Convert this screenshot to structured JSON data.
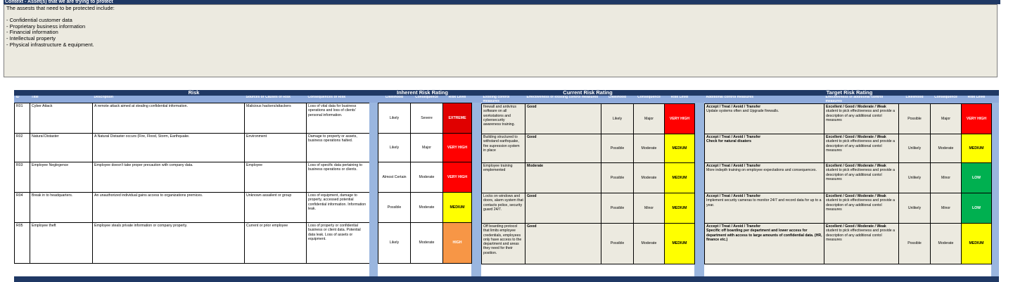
{
  "context": {
    "heading": "Context - Asset(s) that we are trying to protect",
    "intro": "The assests that need to be protected include:",
    "assets": [
      "- Confidential customer data",
      "- Proprietary business information",
      "- Financial information",
      "- Intellectual property",
      "- Physical infrastructure & equipment."
    ]
  },
  "colors": {
    "header_blue": "#1f3864",
    "subheader_blue": "#8eaadb",
    "extreme": "#e00000",
    "very_high": "#ff0000",
    "high": "#f79646",
    "medium": "#ffff00",
    "low": "#00b050"
  },
  "risk": {
    "title": "Risk",
    "headers": [
      "ID",
      "Title",
      "Description",
      "Sources or Causes of Risk",
      "Consequences of Risk"
    ]
  },
  "inherent": {
    "title": "Inherent Risk Rating",
    "headers": [
      "Likelihood",
      "Consequence",
      "Risk Level"
    ]
  },
  "current": {
    "title": "Current Risk Rating",
    "headers": [
      "Existing control measures",
      "Effectiveness of existing control measures",
      "Likelihood",
      "Consequence",
      "Risk Level"
    ]
  },
  "target": {
    "title": "Target Risk Rating",
    "headers": [
      "Additional control measures",
      "Effectiveness of additional control measures",
      "Likelihood",
      "Consequence",
      "Risk Level"
    ]
  },
  "rows": [
    {
      "id": "R01",
      "title": "Cyber Attack",
      "description": "A remote attack aimed at stealing confidential information.",
      "source": "Malicious hackers/attackers",
      "consequence": "Loss of vital data for business operations and loss of clients' personal information.",
      "inh_likelihood": "Likely",
      "inh_consequence": "Severe",
      "inh_level": "EXTREME",
      "existing": "firewall and antivirus software on all workstations and cybersecurity awareness training.",
      "existing_eff": "Good",
      "cur_likelihood": "Likely",
      "cur_consequence": "Major",
      "cur_level": "VERY HIGH",
      "add_head": "Accept / Treat / Avoid / Transfer",
      "add_text": "Update systems often and Upgrade firewalls.",
      "add_eff_head": "Excellent / Good / Moderate / Weak",
      "add_eff_text": "student to pick effectiveness and provide a description of any additional contol measures",
      "tgt_likelihood": "Possible",
      "tgt_consequence": "Major",
      "tgt_level": "VERY HIGH"
    },
    {
      "id": "R02",
      "title": "Natural Distaster",
      "description": "A Natural Distaster occurs (Fire, Flood, Storm, Earthquake.",
      "source": "Environment",
      "consequence": "Damage to property or assets, business operations halted.",
      "inh_likelihood": "Likely",
      "inh_consequence": "Major",
      "inh_level": "VERY HIGH",
      "existing": "Building structured to withstand earthquake, fire supression system in place",
      "existing_eff": "Good",
      "cur_likelihood": "Possible",
      "cur_consequence": "Moderate",
      "cur_level": "MEDIUM",
      "add_head": "Accept / Treat / Avoid / Transfer",
      "add_text": "Check for natural disaters",
      "add_eff_head": "Excellent / Good / Moderate / Weak",
      "add_eff_text": "student to pick effectiveness and provide a description of any additional contol measures",
      "tgt_likelihood": "Unlikely",
      "tgt_consequence": "Moderate",
      "tgt_level": "MEDIUM"
    },
    {
      "id": "R03",
      "title": "Employee Neglegence",
      "description": "Employee doesn't take proper precaution with company data.",
      "source": "Employee",
      "consequence": "Loss of specific data pertaining to business operations or clients.",
      "inh_likelihood": "Almost Certain",
      "inh_consequence": "Moderate",
      "inh_level": "VERY HIGH",
      "existing": "Employee training emplemented",
      "existing_eff": "Moderate",
      "cur_likelihood": "Possible",
      "cur_consequence": "Moderate",
      "cur_level": "MEDIUM",
      "add_head": "Accept / Treat / Avoid / Transfer",
      "add_text": "More indepth training on employee expectations and consequences.",
      "add_eff_head": "Excellent / Good / Moderate / Weak",
      "add_eff_text": "student to pick effectiveness and provide a description of any additional contol measures",
      "tgt_likelihood": "Unlikely",
      "tgt_consequence": "Minor",
      "tgt_level": "LOW"
    },
    {
      "id": "R04",
      "title": "Break in to headquarters.",
      "description": "An unauthorized individual gains access to organizations premices.",
      "source": "Unknown assailent or group",
      "consequence": "Loss of equipment, damage to property, accessed potential confidential information. Information leak.",
      "inh_likelihood": "Possible",
      "inh_consequence": "Moderate",
      "inh_level": "MEDIUM",
      "existing": "Locks on windows and doors, alarm system that contacts police, security guard 24/7.",
      "existing_eff": "Good",
      "cur_likelihood": "Possible",
      "cur_consequence": "Minor",
      "cur_level": "MEDIUM",
      "add_head": "Accept / Treat / Avoid / Transfer",
      "add_text": "Implement security cameras to monitor 24/7 and record data for up to a year.",
      "add_eff_head": "Excellent / Good / Moderate / Weak",
      "add_eff_text": "student to pick effectiveness and provide a description of any additional contol measures",
      "tgt_likelihood": "Unlikely",
      "tgt_consequence": "Minor",
      "tgt_level": "LOW"
    },
    {
      "id": "R05",
      "title": "Employee theft",
      "description": "Employee steals private information or company property.",
      "source": "Current or prior employee",
      "consequence": "Loss of property or confidential business or client data. Potential data leak. Loss of assets or equipment.",
      "inh_likelihood": "Likely",
      "inh_consequence": "Moderate",
      "inh_level": "HIGH",
      "existing": "Off boarding protocol that limits employee credentials, employees only have access to the department and areas they need for their position.",
      "existing_eff": "Good",
      "cur_likelihood": "Possible",
      "cur_consequence": "Moderate",
      "cur_level": "MEDIUM",
      "add_head": "Accept / Treat / Avoid / Transfer",
      "add_text": "Specific off boarding per department and lower access for department with access to large amounts of confidential data. (HR, finance etc.)",
      "add_eff_head": "Excellent / Good / Moderate / Weak",
      "add_eff_text": "student to pick effectiveness and provide a description of any additional contol measures",
      "tgt_likelihood": "Possible",
      "tgt_consequence": "Moderate",
      "tgt_level": "MEDIUM"
    }
  ]
}
